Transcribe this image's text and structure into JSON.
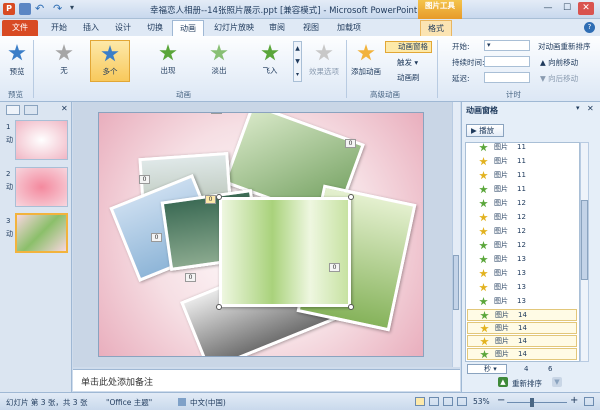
{
  "window": {
    "title": "幸福恋人相册--14张照片展示.ppt [兼容模式] - Microsoft PowerPoint (…",
    "context_tab": "图片工具",
    "controls": [
      "—",
      "☐",
      "✕"
    ]
  },
  "tabs": [
    {
      "label": "文件"
    },
    {
      "label": "开始"
    },
    {
      "label": "插入"
    },
    {
      "label": "设计"
    },
    {
      "label": "切换"
    },
    {
      "label": "动画"
    },
    {
      "label": "幻灯片放映"
    },
    {
      "label": "审阅"
    },
    {
      "label": "视图"
    },
    {
      "label": "加载项"
    },
    {
      "label": "格式"
    }
  ],
  "ribbon": {
    "preview_label": "预览",
    "preview_group": "预览",
    "effects": [
      {
        "label": "无",
        "color": "#a6a6a6"
      },
      {
        "label": "多个",
        "color": "#3b7ec8"
      },
      {
        "label": "出现",
        "color": "#5aa63a"
      },
      {
        "label": "淡出",
        "color": "#5aa63a"
      },
      {
        "label": "飞入",
        "color": "#5aa63a"
      }
    ],
    "effect_options": "效果选项",
    "animation_group": "动画",
    "add_animation": "添加动画",
    "animation_pane": "动画窗格",
    "trigger": "触发",
    "painter": "动画刷",
    "advanced_group": "高级动画",
    "start_label": "开始:",
    "duration_label": "持续时间:",
    "delay_label": "延迟:",
    "reorder_title": "对动画重新排序",
    "move_earlier": "向前移动",
    "move_later": "向后移动",
    "timing_group": "计时"
  },
  "slides": [
    {
      "num": "1",
      "label": "动"
    },
    {
      "num": "2",
      "label": "动"
    },
    {
      "num": "3",
      "label": "动"
    }
  ],
  "notes_placeholder": "单击此处添加备注",
  "pane": {
    "title": "动画窗格",
    "play": "播放",
    "items": [
      {
        "n": "8",
        "name": "图片",
        "num": "11"
      },
      {
        "n": "",
        "name": "图片",
        "num": "11"
      },
      {
        "n": "",
        "name": "图片",
        "num": "11"
      },
      {
        "n": "",
        "name": "图片",
        "num": "11"
      },
      {
        "n": "",
        "name": "图片",
        "num": "12"
      },
      {
        "n": "",
        "name": "图片",
        "num": "12"
      },
      {
        "n": "",
        "name": "图片",
        "num": "12"
      },
      {
        "n": "",
        "name": "图片",
        "num": "12"
      },
      {
        "n": "",
        "name": "图片",
        "num": "13"
      },
      {
        "n": "",
        "name": "图片",
        "num": "13"
      },
      {
        "n": "",
        "name": "图片",
        "num": "13"
      },
      {
        "n": "",
        "name": "图片",
        "num": "13"
      },
      {
        "n": "",
        "name": "图片",
        "num": "14"
      },
      {
        "n": "",
        "name": "图片",
        "num": "14"
      },
      {
        "n": "",
        "name": "图片",
        "num": "14"
      },
      {
        "n": "",
        "name": "图片",
        "num": "14"
      }
    ],
    "seconds_label": "秒",
    "scale_a": "4",
    "scale_b": "6",
    "reorder": "重新排序"
  },
  "status": {
    "slide_info": "幻灯片 第 3 张，共 3 张",
    "theme": "\"Office 主题\"",
    "language": "中文(中国)",
    "zoom": "53%"
  },
  "colors": {
    "accent": "#f2b33d",
    "file_tab": "#d84a23",
    "ribbon_bg": "#dce7f5"
  }
}
